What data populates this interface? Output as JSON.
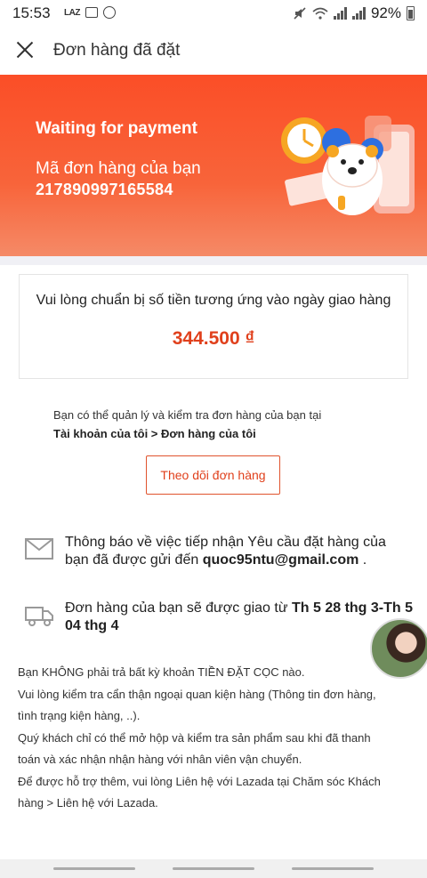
{
  "status_bar": {
    "time": "15:53",
    "app_badge": "LAZ",
    "battery": "92%"
  },
  "header": {
    "title": "Đơn hàng đã đặt"
  },
  "banner": {
    "status": "Waiting for payment",
    "order_label": "Mã đơn hàng của bạn",
    "order_number": "217890997165584"
  },
  "payment": {
    "note": "Vui lòng chuẩn bị số tiền tương ứng vào ngày giao hàng",
    "amount": "344.500 ₫"
  },
  "manage": {
    "text": "Bạn có thể quản lý và kiểm tra đơn hàng của bạn tại",
    "path": "Tài khoản của tôi > Đơn hàng của tôi",
    "track_button": "Theo dõi đơn hàng"
  },
  "email_info": {
    "text": "Thông báo về việc tiếp nhận Yêu cầu đặt hàng của bạn đã được gửi đến ",
    "email": "quoc95ntu@gmail.com",
    "suffix": " ."
  },
  "delivery_info": {
    "text": "Đơn hàng của bạn sẽ được giao từ ",
    "range": "Th 5 28 thg 3-Th 5 04 thg 4"
  },
  "notes": [
    "Bạn KHÔNG phải trả bất kỳ khoản TIỀN ĐẶT CỌC nào.",
    "Vui lòng kiểm tra cẩn thận ngoại quan kiện hàng (Thông tin đơn hàng, tình trạng kiện hàng, ..).",
    "Quý khách chỉ có thể mở hộp và kiểm tra sản phẩm sau khi đã thanh toán và xác nhận nhận hàng với nhân viên vận chuyển.",
    "Để được hỗ trợ thêm, vui lòng Liên hệ với Lazada tại Chăm sóc Khách hàng > Liên hệ với Lazada."
  ],
  "colors": {
    "brand_orange": "#fb4e27",
    "accent_text": "#e0401c"
  }
}
